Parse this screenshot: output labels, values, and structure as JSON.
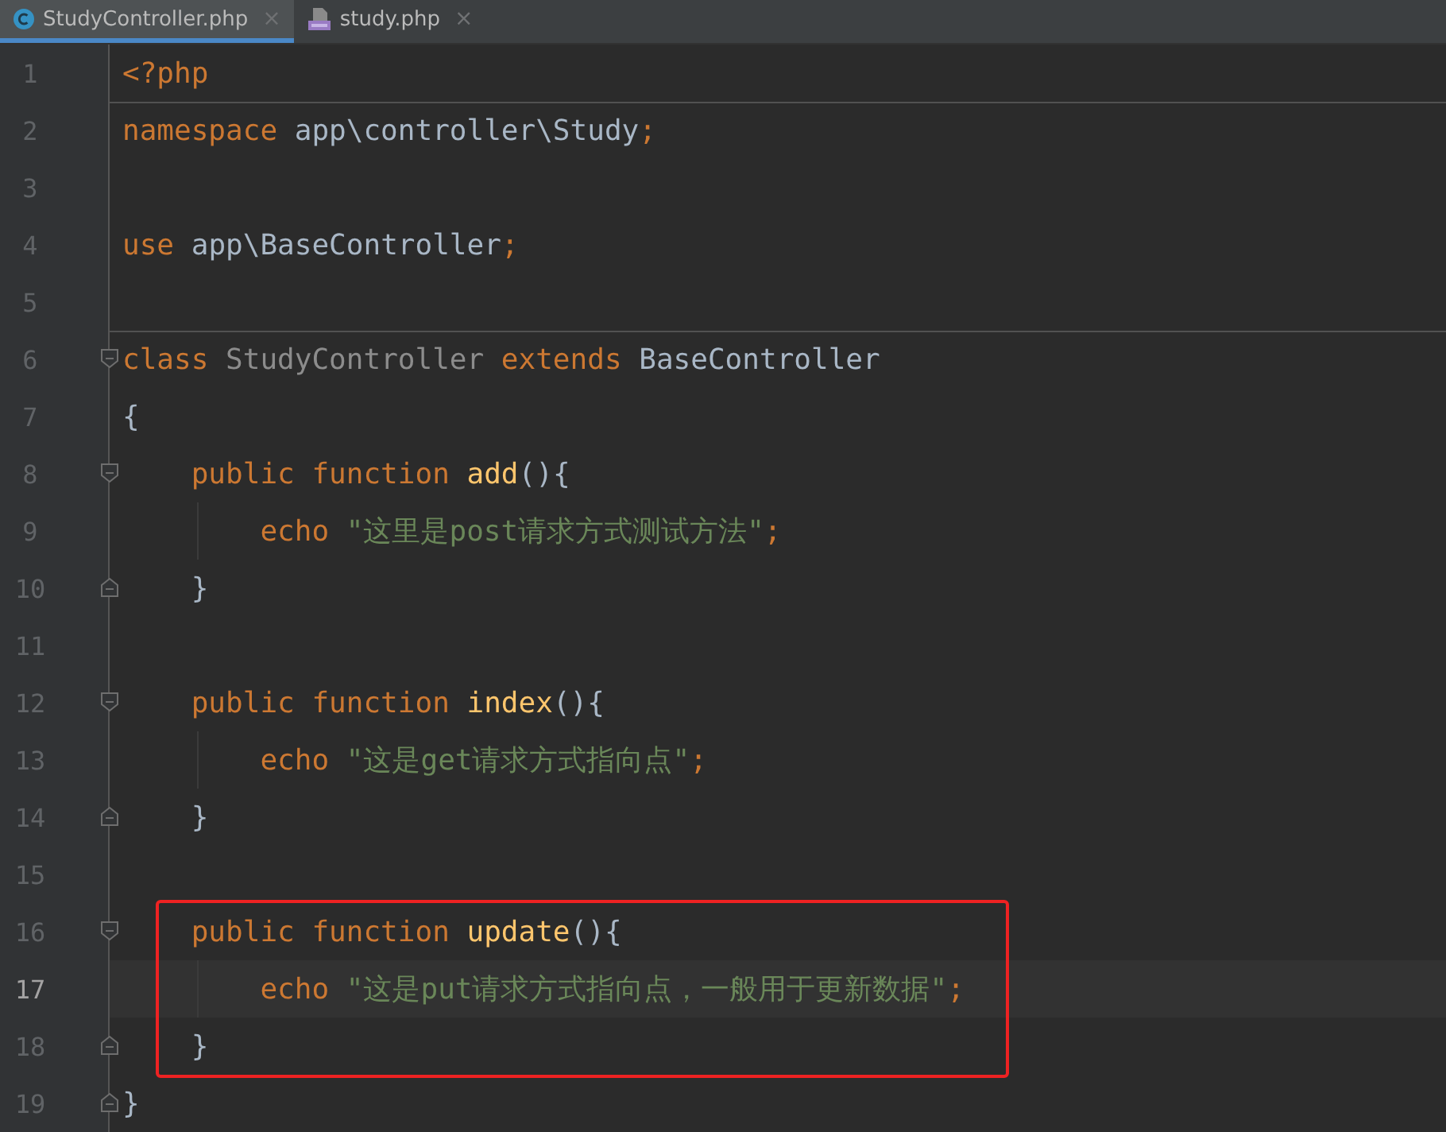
{
  "tabs": [
    {
      "label": "StudyController.php",
      "kind": "class",
      "selected": true,
      "close": "×"
    },
    {
      "label": "study.php",
      "kind": "php",
      "selected": false,
      "close": "×"
    }
  ],
  "lines": [
    {
      "number": "1",
      "tokens": [
        {
          "kind": "keyword",
          "text": "<?php"
        }
      ]
    },
    {
      "number": "2",
      "separator": true,
      "tokens": [
        {
          "kind": "keyword",
          "text": "namespace "
        },
        {
          "kind": "plain",
          "text": "app\\controller\\Study"
        },
        {
          "kind": "keyword",
          "text": ";"
        }
      ]
    },
    {
      "number": "3"
    },
    {
      "number": "4",
      "tokens": [
        {
          "kind": "keyword",
          "text": "use "
        },
        {
          "kind": "plain",
          "text": "app\\BaseController"
        },
        {
          "kind": "keyword",
          "text": ";"
        }
      ]
    },
    {
      "number": "5"
    },
    {
      "number": "6",
      "separator": true,
      "fold_open": true,
      "tokens": [
        {
          "kind": "keyword",
          "text": "class "
        },
        {
          "kind": "dim",
          "text": "StudyController "
        },
        {
          "kind": "keyword",
          "text": "extends "
        },
        {
          "kind": "plain",
          "text": "BaseController"
        }
      ]
    },
    {
      "number": "7",
      "tokens": [
        {
          "kind": "plain",
          "text": "{"
        }
      ]
    },
    {
      "number": "8",
      "fold_open": true,
      "tokens": [
        {
          "kind": "keyword",
          "text": "    public function "
        },
        {
          "kind": "function",
          "text": "add"
        },
        {
          "kind": "plain",
          "text": "(){"
        }
      ]
    },
    {
      "number": "9",
      "guide": true,
      "tokens": [
        {
          "kind": "keyword",
          "text": "        echo "
        },
        {
          "kind": "string",
          "text": "\"这里是post请求方式测试方法\""
        },
        {
          "kind": "keyword",
          "text": ";"
        }
      ]
    },
    {
      "number": "10",
      "fold_close": true,
      "tokens": [
        {
          "kind": "plain",
          "text": "    }"
        }
      ]
    },
    {
      "number": "11"
    },
    {
      "number": "12",
      "fold_open": true,
      "tokens": [
        {
          "kind": "keyword",
          "text": "    public function "
        },
        {
          "kind": "function",
          "text": "index"
        },
        {
          "kind": "plain",
          "text": "(){"
        }
      ]
    },
    {
      "number": "13",
      "guide": true,
      "tokens": [
        {
          "kind": "keyword",
          "text": "        echo "
        },
        {
          "kind": "string",
          "text": "\"这是get请求方式指向点\""
        },
        {
          "kind": "keyword",
          "text": ";"
        }
      ]
    },
    {
      "number": "14",
      "fold_close": true,
      "tokens": [
        {
          "kind": "plain",
          "text": "    }"
        }
      ]
    },
    {
      "number": "15"
    },
    {
      "number": "16",
      "fold_open": true,
      "boxed": true,
      "tokens": [
        {
          "kind": "keyword",
          "text": "    public function "
        },
        {
          "kind": "function",
          "text": "update"
        },
        {
          "kind": "plain",
          "text": "(){"
        }
      ]
    },
    {
      "number": "17",
      "current": true,
      "guide": true,
      "boxed": true,
      "tokens": [
        {
          "kind": "keyword",
          "text": "        echo "
        },
        {
          "kind": "string",
          "text": "\"这是put请求方式指向点，一般用于更新数据\""
        },
        {
          "kind": "keyword",
          "text": ";"
        }
      ]
    },
    {
      "number": "18",
      "fold_close": true,
      "boxed": true,
      "tokens": [
        {
          "kind": "plain",
          "text": "    }"
        }
      ]
    },
    {
      "number": "19",
      "fold_close": true,
      "tokens": [
        {
          "kind": "plain",
          "text": "}"
        }
      ]
    }
  ]
}
